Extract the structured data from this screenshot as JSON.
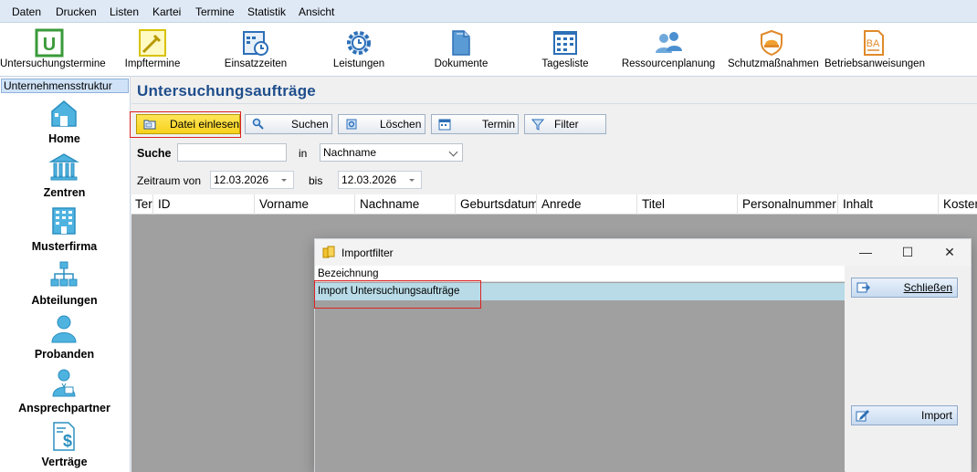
{
  "menu": [
    "Daten",
    "Drucken",
    "Listen",
    "Kartei",
    "Termine",
    "Statistik",
    "Ansicht"
  ],
  "toolbar": [
    {
      "label": "Untersuchungstermine",
      "icon": "u-letter-icon"
    },
    {
      "label": "Impftermine",
      "icon": "syringe-icon"
    },
    {
      "label": "Einsatzzeiten",
      "icon": "calendar-clock-icon"
    },
    {
      "label": "Leistungen",
      "icon": "gear-clock-icon"
    },
    {
      "label": "Dokumente",
      "icon": "documents-icon"
    },
    {
      "label": "Tagesliste",
      "icon": "day-list-icon"
    },
    {
      "label": "Ressourcenplanung",
      "icon": "people-icon"
    },
    {
      "label": "Schutzmaßnahmen",
      "icon": "helmet-icon"
    },
    {
      "label": "Betriebsanweisungen",
      "icon": "ba-document-icon"
    }
  ],
  "sidebar": {
    "tab": "Unternehmensstruktur",
    "items": [
      {
        "label": "Home",
        "icon": "home-icon"
      },
      {
        "label": "Zentren",
        "icon": "institution-icon"
      },
      {
        "label": "Musterfirma",
        "icon": "building-icon"
      },
      {
        "label": "Abteilungen",
        "icon": "org-chart-icon"
      },
      {
        "label": "Probanden",
        "icon": "person-icon"
      },
      {
        "label": "Ansprechpartner",
        "icon": "contact-person-icon"
      },
      {
        "label": "Verträge",
        "icon": "contract-icon"
      }
    ]
  },
  "main": {
    "title": "Untersuchungsaufträge",
    "buttons": {
      "import": "Datei einlesen",
      "search": "Suchen",
      "delete": "Löschen",
      "appointment": "Termin",
      "filter": "Filter"
    },
    "search_label": "Suche",
    "search_value": "",
    "in_label": "in",
    "field_select": "Nachname",
    "period_label": "Zeitraum von",
    "date_from": "12.03.2026",
    "to_label": "bis",
    "date_to": "12.03.2026",
    "columns": [
      "Ter",
      "ID",
      "Vorname",
      "Nachname",
      "Geburtsdatum",
      "Anrede",
      "Titel",
      "Personalnummer",
      "Inhalt",
      "Kosten"
    ]
  },
  "dialog": {
    "title": "Importfilter",
    "column": "Bezeichnung",
    "rows": [
      "Import Untersuchungsaufträge"
    ],
    "close_button": "Schließen",
    "import_button": "Import",
    "minimize": "—",
    "maximize": "☐",
    "close": "✕"
  },
  "colors": {
    "accent": "#1f4e8c",
    "highlight": "#f7d21c",
    "selection": "#b8dbe7",
    "annotation": "#dd2222"
  }
}
